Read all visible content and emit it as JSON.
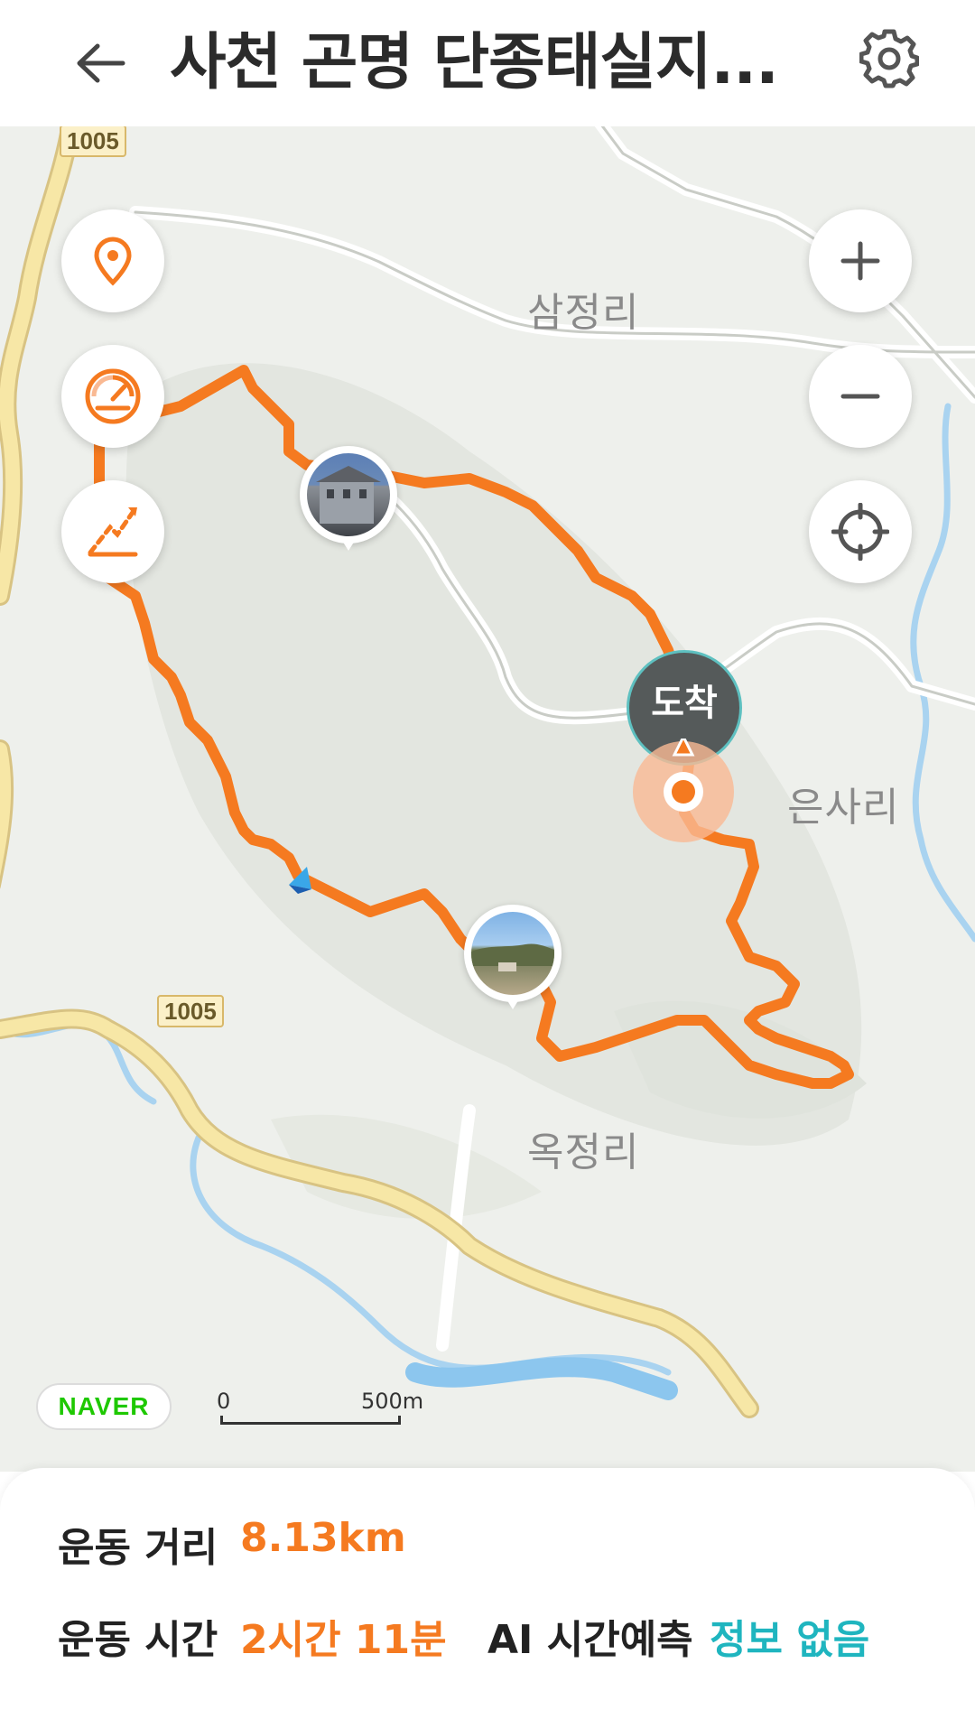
{
  "header": {
    "title": "사천 곤명 단종태실지...",
    "back_icon": "arrow-left-icon",
    "settings_icon": "gear-icon"
  },
  "map": {
    "place_labels": {
      "samjeong": "삼정리",
      "eunsa": "은사리",
      "okjeong": "옥정리"
    },
    "road_signs": {
      "top": "1005",
      "middle": "1005"
    },
    "arrival_label": "도착",
    "provider": "NAVER",
    "scale": {
      "start": "0",
      "end": "500m"
    },
    "controls": {
      "pin_icon": "location-pin-icon",
      "speed_icon": "speedometer-icon",
      "elevation_icon": "elevation-icon",
      "zoom_in_icon": "plus-icon",
      "zoom_out_icon": "minus-icon",
      "locate_icon": "crosshair-icon"
    },
    "colors": {
      "route": "#f57a20",
      "accent_teal": "#1fb5bf",
      "road_yellow": "#f5e39a",
      "water": "#a9d3f0"
    }
  },
  "stats": {
    "distance_label": "운동 거리",
    "distance_value": "8.13km",
    "time_label": "운동 시간",
    "time_value": "2시간 11분",
    "ai_label": "AI 시간예측",
    "ai_value": "정보 없음"
  }
}
